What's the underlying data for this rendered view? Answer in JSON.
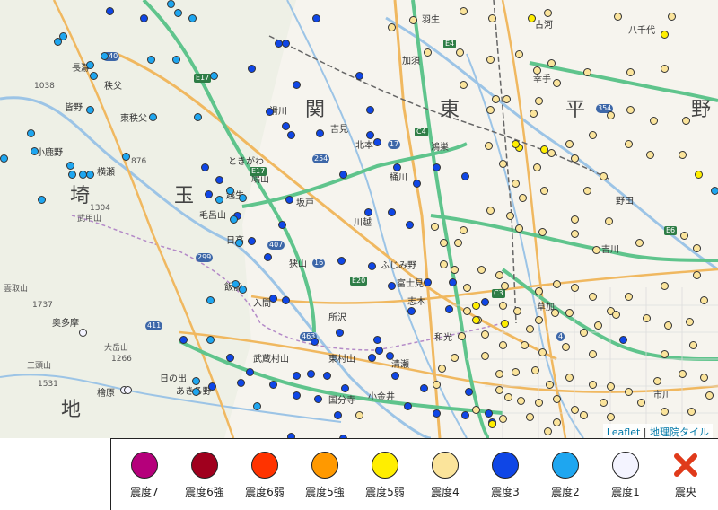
{
  "map": {
    "places": [
      {
        "name": "長瀞"
      },
      {
        "name": "秩父"
      },
      {
        "name": "皆野"
      },
      {
        "name": "東秩父"
      },
      {
        "name": "小鹿野"
      },
      {
        "name": "横瀬"
      },
      {
        "name": "滑川"
      },
      {
        "name": "吉見"
      },
      {
        "name": "北本"
      },
      {
        "name": "桶川"
      },
      {
        "name": "鴻巣"
      },
      {
        "name": "ときがわ"
      },
      {
        "name": "鳩山"
      },
      {
        "name": "越生"
      },
      {
        "name": "毛呂山"
      },
      {
        "name": "日高"
      },
      {
        "name": "坂戸"
      },
      {
        "name": "川越"
      },
      {
        "name": "狭山"
      },
      {
        "name": "所沢"
      },
      {
        "name": "入間"
      },
      {
        "name": "飯能"
      },
      {
        "name": "ふじみ野"
      },
      {
        "name": "富士見"
      },
      {
        "name": "志木"
      },
      {
        "name": "和光"
      },
      {
        "name": "東村山"
      },
      {
        "name": "武蔵村山"
      },
      {
        "name": "国分寺"
      },
      {
        "name": "小金井"
      },
      {
        "name": "清瀬"
      },
      {
        "name": "羽生"
      },
      {
        "name": "加須"
      },
      {
        "name": "古河"
      },
      {
        "name": "八千代"
      },
      {
        "name": "幸手"
      },
      {
        "name": "吉川"
      },
      {
        "name": "草加"
      },
      {
        "name": "市川"
      },
      {
        "name": "野田"
      },
      {
        "name": "あきる野"
      },
      {
        "name": "日の出"
      },
      {
        "name": "奥多摩"
      },
      {
        "name": "檜原"
      },
      {
        "name": "三頭山"
      },
      {
        "name": "大岳山"
      },
      {
        "name": "武甲山"
      },
      {
        "name": "雲取山"
      },
      {
        "name": "関"
      },
      {
        "name": "東"
      },
      {
        "name": "平"
      },
      {
        "name": "野"
      },
      {
        "name": "埼"
      },
      {
        "name": "玉"
      },
      {
        "name": "地"
      }
    ],
    "elevations": [
      "1038",
      "876",
      "1304",
      "1737",
      "1266",
      "1531"
    ],
    "routes": [
      "140",
      "E17",
      "E17",
      "254",
      "17",
      "C4",
      "E4",
      "16",
      "407",
      "E6",
      "C3",
      "299",
      "411",
      "463",
      "E20",
      "354",
      "4"
    ],
    "observations": {
      "colors": {
        "7": "#b5007b",
        "6+": "#a0001e",
        "6-": "#ff3300",
        "5+": "#ff9900",
        "5-": "#ffee00",
        "4": "#fbe49b",
        "3": "#0f46e6",
        "2": "#1ea6f0",
        "1": "#f4f4ff"
      }
    },
    "attribution": {
      "leaflet": "Leaflet",
      "sep": " | ",
      "tiles": "地理院タイル"
    }
  },
  "legend": {
    "items": [
      {
        "label": "震度7",
        "color": "#b5007b"
      },
      {
        "label": "震度6強",
        "color": "#a0001e"
      },
      {
        "label": "震度6弱",
        "color": "#ff3300"
      },
      {
        "label": "震度5強",
        "color": "#ff9900"
      },
      {
        "label": "震度5弱",
        "color": "#ffee00"
      },
      {
        "label": "震度4",
        "color": "#fbe49b"
      },
      {
        "label": "震度3",
        "color": "#0f46e6"
      },
      {
        "label": "震度2",
        "color": "#1ea6f0"
      },
      {
        "label": "震度1",
        "color": "#f4f4ff"
      }
    ],
    "epicenter": {
      "label": "震央",
      "color": "#e03a1a"
    }
  }
}
